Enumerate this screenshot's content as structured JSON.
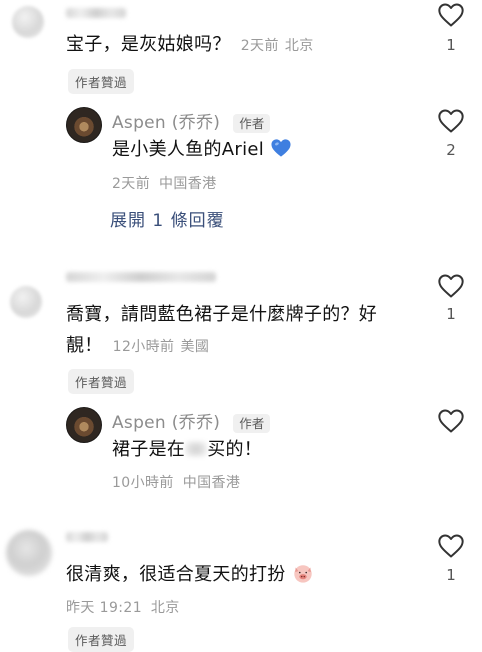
{
  "comments": [
    {
      "text": "宝子，是灰姑娘吗？",
      "time": "2天前",
      "location": "北京",
      "likes": "1",
      "liked_by_author": "作者贊過",
      "reply": {
        "name": "Aspen (乔乔)",
        "author_tag": "作者",
        "text": "是小美人鱼的Ariel",
        "emoji": "blue-heart",
        "time": "2天前",
        "location": "中国香港",
        "likes": "2"
      },
      "expand_label": "展開 1 條回覆"
    },
    {
      "text_line1": "喬寶，請問藍色裙子是什麼牌子的？好",
      "text_line2": "靚！",
      "time": "12小時前",
      "location": "美國",
      "likes": "1",
      "liked_by_author": "作者贊過",
      "reply": {
        "name": "Aspen (乔乔)",
        "author_tag": "作者",
        "text_part1": "裙子是在",
        "text_part2": "买的！",
        "time": "10小時前",
        "location": "中国香港"
      }
    },
    {
      "text": "很清爽，很适合夏天的打扮",
      "emoji": "pig-emoji",
      "time": "昨天 19:21",
      "location": "北京",
      "likes": "1",
      "liked_by_author": "作者贊過"
    }
  ]
}
